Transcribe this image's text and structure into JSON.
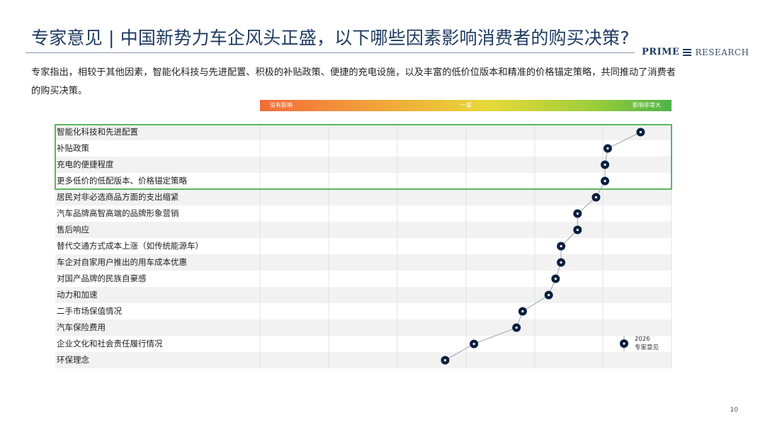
{
  "title": "专家意见 | 中国新势力车企风头正盛，以下哪些因素影响消费者的购买决策?",
  "logo": {
    "prime": "PRIME",
    "research": "RESEARCH"
  },
  "summary": "专家指出，相较于其他因素，智能化科技与先进配置、积极的补贴政策、便捷的充电设施，以及丰富的低价位版本和精准的价格锚定策略，共同推动了消费者的购买决策。",
  "scale": {
    "low": "没有影响",
    "mid": "一般",
    "high": "影响非常大"
  },
  "colors": {
    "dot": "#0b1f3f",
    "highlight": "#5cb85c",
    "line": "#9aa5b3",
    "band": "#f2f2f2"
  },
  "chart_data": {
    "type": "scatter",
    "orientation": "horizontal",
    "categories": [
      "智能化科技和先进配置",
      "补贴政策",
      "充电的便捷程度",
      "更多低价的低配版本、价格锚定策略",
      "居民对非必选商品方面的支出缩紧",
      "汽车品牌高智高端的品牌形象营销",
      "售后响应",
      "替代交通方式成本上涨（如传统能源车）",
      "车企对自家用户推出的用车成本优惠",
      "对国产品牌的民族自豪感",
      "动力和加速",
      "二手市场保值情况",
      "汽车保险费用",
      "企业文化和社会责任履行情况",
      "环保理念"
    ],
    "values": [
      5.55,
      5.07,
      5.03,
      5.03,
      4.9,
      4.63,
      4.63,
      4.39,
      4.39,
      4.31,
      4.21,
      3.83,
      3.74,
      3.12,
      2.7
    ],
    "xlim": [
      0,
      6
    ],
    "highlighted": [
      0,
      1,
      2,
      3
    ],
    "series": [
      {
        "name": "2026\n专家意见",
        "values": [
          5.55,
          5.07,
          5.03,
          5.03,
          4.9,
          4.63,
          4.63,
          4.39,
          4.39,
          4.31,
          4.21,
          3.83,
          3.74,
          3.12,
          2.7
        ]
      }
    ],
    "legend": {
      "line1": "2026",
      "line2": "专家意见",
      "position": "bottom-right"
    }
  },
  "page_number": "10"
}
